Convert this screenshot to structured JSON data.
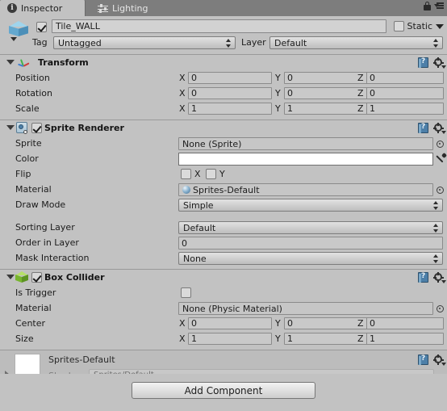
{
  "window": {
    "tabs": [
      {
        "label": "Inspector",
        "icon": "info-icon",
        "active": true
      },
      {
        "label": "Lighting",
        "icon": "sliders-icon",
        "active": false
      }
    ],
    "lock_icon": "lock-icon",
    "menu_icon": "hamburger-menu-icon"
  },
  "gameobject": {
    "icon": "cube-icon",
    "enabled": true,
    "name": "Tile_WALL",
    "static_label": "Static",
    "static_checked": false,
    "tag_label": "Tag",
    "tag_value": "Untagged",
    "layer_label": "Layer",
    "layer_value": "Default"
  },
  "components": [
    {
      "id": "transform",
      "title": "Transform",
      "icon": "transform-axes-icon",
      "has_enable_checkbox": false,
      "rows": [
        {
          "label": "Position",
          "type": "vector3",
          "x": "0",
          "y": "0",
          "z": "0"
        },
        {
          "label": "Rotation",
          "type": "vector3",
          "x": "0",
          "y": "0",
          "z": "0"
        },
        {
          "label": "Scale",
          "type": "vector3",
          "x": "1",
          "y": "1",
          "z": "1"
        }
      ]
    },
    {
      "id": "sprite-renderer",
      "title": "Sprite Renderer",
      "icon": "sprite-renderer-icon",
      "has_enable_checkbox": true,
      "enabled": true,
      "rows": [
        {
          "label": "Sprite",
          "type": "object",
          "value": "None (Sprite)"
        },
        {
          "label": "Color",
          "type": "color",
          "value": "#FFFFFF"
        },
        {
          "label": "Flip",
          "type": "flip",
          "x_label": "X",
          "y_label": "Y",
          "x_checked": false,
          "y_checked": false
        },
        {
          "label": "Material",
          "type": "object-material",
          "value": "Sprites-Default"
        },
        {
          "label": "Draw Mode",
          "type": "popup",
          "value": "Simple"
        },
        {
          "label": "Sorting Layer",
          "type": "popup",
          "value": "Default"
        },
        {
          "label": "Order in Layer",
          "type": "number",
          "value": "0"
        },
        {
          "label": "Mask Interaction",
          "type": "popup",
          "value": "None"
        }
      ]
    },
    {
      "id": "box-collider",
      "title": "Box Collider",
      "icon": "box-collider-icon",
      "has_enable_checkbox": true,
      "enabled": true,
      "rows": [
        {
          "label": "Is Trigger",
          "type": "bool",
          "checked": false
        },
        {
          "label": "Material",
          "type": "object",
          "value": "None (Physic Material)"
        },
        {
          "label": "Center",
          "type": "vector3",
          "x": "0",
          "y": "0",
          "z": "0"
        },
        {
          "label": "Size",
          "type": "vector3",
          "x": "1",
          "y": "1",
          "z": "1"
        }
      ]
    }
  ],
  "axis_labels": {
    "x": "X",
    "y": "Y",
    "z": "Z"
  },
  "material_preview": {
    "name": "Sprites-Default",
    "shader_label": "Shader",
    "shader_value": "Sprites/Default"
  },
  "add_component": {
    "label": "Add Component"
  },
  "colors": {
    "background": "#c2c2c2",
    "tabbar": "#7d7d7d",
    "field": "#c9c9c9",
    "accent_blue": "#4d7fa8",
    "collider_green": "#77b52e"
  }
}
